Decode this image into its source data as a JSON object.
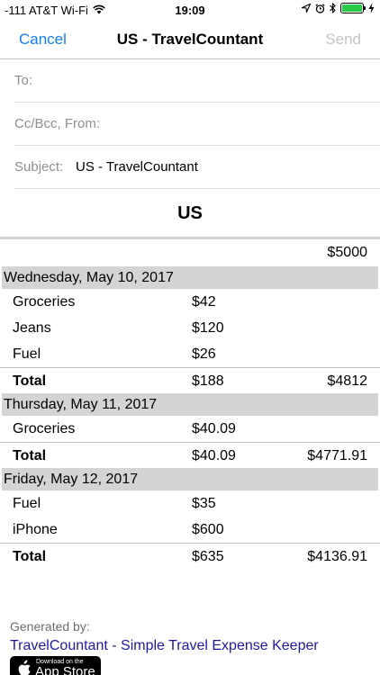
{
  "status_bar": {
    "carrier": "-111 AT&T Wi-Fi",
    "time": "19:09"
  },
  "nav": {
    "cancel": "Cancel",
    "title": "US - TravelCountant",
    "send": "Send"
  },
  "fields": {
    "to_label": "To:",
    "ccbcc_label": "Cc/Bcc, From:",
    "subject_label": "Subject:",
    "subject_value": "US - TravelCountant"
  },
  "report": {
    "title": "US",
    "starting_balance": "$5000",
    "days": [
      {
        "date": "Wednesday, May 10, 2017",
        "items": [
          {
            "name": "Groceries",
            "amount": "$42"
          },
          {
            "name": "Jeans",
            "amount": "$120"
          },
          {
            "name": "Fuel",
            "amount": "$26"
          }
        ],
        "total_label": "Total",
        "total": "$188",
        "balance": "$4812"
      },
      {
        "date": "Thursday, May 11, 2017",
        "items": [
          {
            "name": "Groceries",
            "amount": "$40.09"
          }
        ],
        "total_label": "Total",
        "total": "$40.09",
        "balance": "$4771.91"
      },
      {
        "date": "Friday, May 12, 2017",
        "items": [
          {
            "name": "Fuel",
            "amount": "$35"
          },
          {
            "name": "iPhone",
            "amount": "$600"
          }
        ],
        "total_label": "Total",
        "total": "$635",
        "balance": "$4136.91"
      }
    ]
  },
  "footer": {
    "generated_by": "Generated by:",
    "link": "TravelCountant - Simple Travel Expense Keeper",
    "badge_small": "Download on the",
    "badge_big": "App Store"
  },
  "colors": {
    "accent": "#147efb",
    "disabled": "#c4c4c8",
    "day_header_bg": "#d4d4d4",
    "link": "#1a1aa6",
    "battery": "#2bc94a"
  }
}
